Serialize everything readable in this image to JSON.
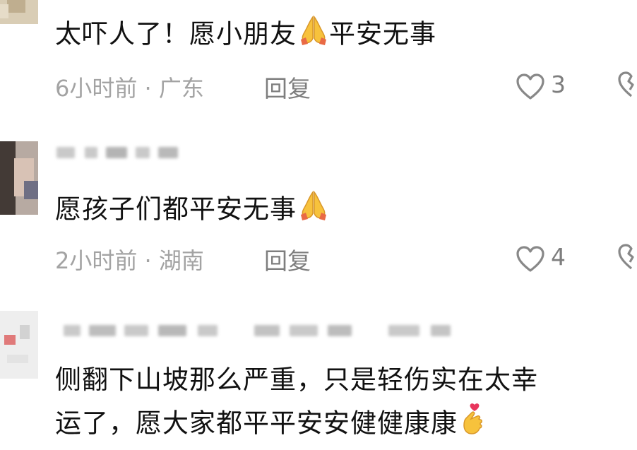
{
  "comments": [
    {
      "text": "太吓人了！愿小朋友",
      "text_after_emoji": "平安无事",
      "emoji": "folded-hands",
      "time": "6小时前",
      "separator": " · ",
      "location": "广东",
      "reply_label": "回复",
      "likes": "3"
    },
    {
      "text": "愿孩子们都平安无事",
      "emoji": "folded-hands",
      "time": "2小时前",
      "separator": " · ",
      "location": "湖南",
      "reply_label": "回复",
      "likes": "4"
    },
    {
      "line1": "侧翻下山坡那么严重，只是轻伤实在太幸",
      "line2": "运了，愿大家都平平安安健健康康",
      "emoji": "hand-with-index-finger-and-thumb-crossed"
    }
  ],
  "colors": {
    "text": "#111111",
    "meta": "#a3a3a3",
    "action": "#7e7e7e",
    "emoji_yellow": "#f7c23c",
    "emoji_heart": "#e8365d"
  }
}
